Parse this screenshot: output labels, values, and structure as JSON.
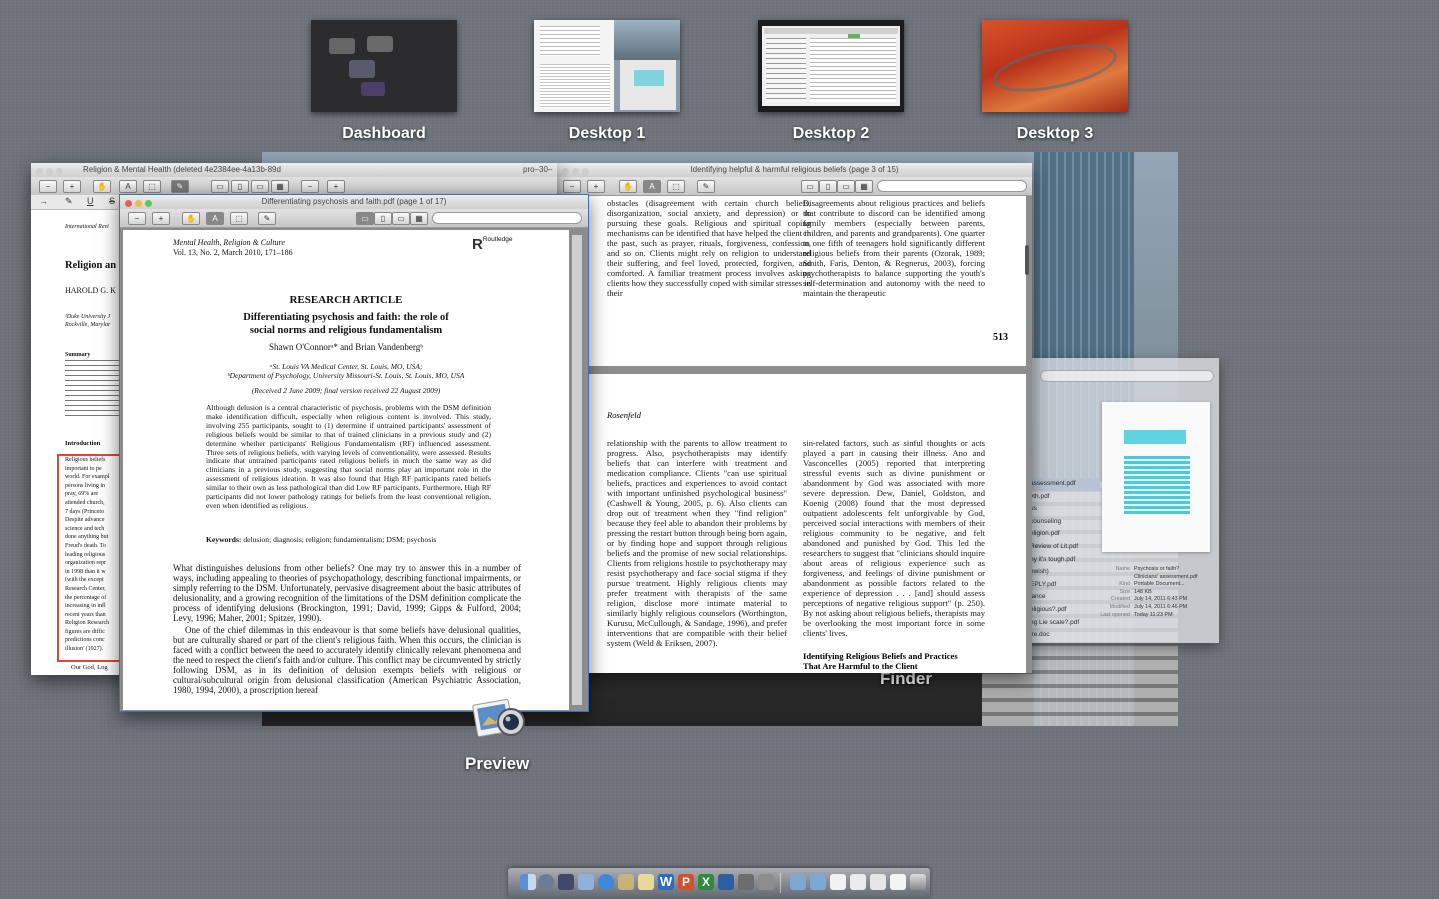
{
  "spaces": [
    {
      "label": "Dashboard"
    },
    {
      "label": "Desktop 1"
    },
    {
      "label": "Desktop 2"
    },
    {
      "label": "Desktop 3"
    }
  ],
  "windows": {
    "left_window": {
      "title": "Religion & Mental Health (deleted 4e2384ee-4a13b-89d",
      "journal": "International Revi",
      "heading": "Religion an",
      "author": "HAROLD G. K",
      "affil1": "¹Duke University J",
      "affil2": "Rockville, Marylar",
      "summary_head": "Summary",
      "intro_head": "Introduction",
      "box_lines": [
        "Religious beliefs",
        "important to pe",
        "world. For exampl",
        "persons living in",
        "pray, 69% are",
        "attended church,",
        "7 days (Princeto",
        "Despite advance",
        "science and tech",
        "done anything but",
        "Freud's death. To",
        "leading religious",
        "organization repr",
        "in 1998 than it w",
        "(with the except",
        "Research Center,",
        "the percentage of",
        "increasing in infl",
        "recent years than",
        "Religion Research",
        "figures are diffic",
        "predictions conc",
        "illusion' (1927)."
      ],
      "tail": "Our God, Log"
    },
    "front_window": {
      "title": "Differentiating psychosis and faith.pdf (page 1 of 17)",
      "journal_name": "Mental Health, Religion & Culture",
      "journal_vol": "Vol. 13, No. 2, March 2010, 171–186",
      "publisher": "Routledge",
      "article_type": "RESEARCH ARTICLE",
      "article_title_1": "Differentiating psychosis and faith: the role of",
      "article_title_2": "social norms and religious fundamentalism",
      "authors": "Shawn O'Connorᵃ* and Brian Vandenbergᵇ",
      "affil_a": "ᵃSt. Louis VA Medical Center, St. Louis, MO, USA;",
      "affil_b": "ᵇDepartment of Psychology, University Missouri-St. Louis, St. Louis, MO, USA",
      "received": "(Received 2 June 2009; final version received 22 August 2009)",
      "abstract": "Although delusion is a central characteristic of psychosis, problems with the DSM definition make identification difficult, especially when religious content is involved. This study, involving 255 participants, sought to (1) determine if untrained participants' assessment of religious beliefs would be similar to that of trained clinicians in a previous study and (2) determine whether participants' Religious Fundamentalism (RF) influenced assessment. Three sets of religious beliefs, with varying levels of conventionality, were assessed. Results indicate that untrained participants rated religious beliefs in much the same way as did clinicians in a previous study, suggesting that social norms play an important role in the assessment of religious ideation. It was also found that High RF participants rated beliefs similar to their own as less pathological than did Low RF participants. Furthermore, High RF participants did not lower pathology ratings for beliefs from the least conventional religion, even when identified as religious.",
      "keywords_label": "Keywords:",
      "keywords": "delusion; diagnosis; religion; fundamentalism; DSM; psychosis",
      "body_p1": "What distinguishes delusions from other beliefs? One may try to answer this in a number of ways, including appealing to theories of psychopathology, describing functional impairments, or simply referring to the DSM. Unfortunately, pervasive disagreement about the basic attributes of delusionality, and a growing recognition of the limitations of the DSM definition complicate the process of identifying delusions (Brockington, 1991; David, 1999; Gipps & Fulford, 2004; Levy, 1996; Maher, 2001; Spitzer, 1990).",
      "body_p2": "One of the chief dilemmas in this endeavour is that some beliefs have delusional qualities, but are culturally shared or part of the client's religious faith. When this occurs, the clinician is faced with a conflict between the need to accurately identify clinically relevant phenomena and the need to respect the client's faith and/or culture. This conflict may be circumvented by strictly following DSM, as in its definition of delusion exempts beliefs with religious or cultural/subcultural origin from delusional classification (American Psychiatric Association, 1980, 1994, 2000), a proscription hereaf"
    },
    "middle_window": {
      "title_stub": "pro–30–",
      "title": "Identifying helpful & harmful religious beliefs (page 3 of 15)",
      "top_left": "obstacles (disagreement with certain church beliefs, disorganization, social anxiety, and depression) or to pursuing these goals. Religious and spiritual coping mechanisms can be identified that have helped the client in the past, such as prayer, rituals, forgiveness, confession, and so on. Clients might rely on religion to understand their suffering, and feel loved, protected, forgiven, and comforted. A familiar treatment process involves asking clients how they successfully coped with similar stresses in their",
      "top_right": "Disagreements about religious practices and beliefs that contribute to discord can be identified among family members (especially between parents, children, and parents and grandparents). One quarter to one fifth of teenagers hold significantly different religious beliefs from their parents (Ozorak, 1989; Smith, Faris, Denton, & Regnerus, 2003), forcing psychotherapists to balance supporting the youth's self-determination and autonomy with the need to maintain the therapeutic",
      "page_number": "513",
      "running_head": "Rosenfeld",
      "bottom_left": "relationship with the parents to allow treatment to progress. Also, psychotherapists may identify beliefs that can interfere with treatment and medication compliance. Clients \"can use spiritual beliefs, practices and experiences to avoid contact with important unfinished psychological business\" (Cashwell & Young, 2005, p. 6). Also clients can drop out of treatment when they \"find religion\" because they feel able to abandon their problems by pressing the restart button through being born again, or by finding hope and support through religious beliefs and the promise of new social relationships. Clients from religions hostile to psychotherapy may resist psychotherapy and face social stigma if they pursue treatment. Highly religious clients may prefer treatment with therapists of the same religion, disclose more intimate material to similarly highly religious counselors (Worthington, Kurusu, McCullough, & Sandage, 1996), and prefer interventions that are compatible with their belief system (Weld & Eriksen, 2007).",
      "bottom_right": "sin-related factors, such as sinful thoughts or acts played a part in causing their illness. Ano and Vasconcelles (2005) reported that interpreting stressful events such as divine punishment or abandonment by God was associated with more severe depression. Dew, Daniel, Goldston, and Koenig (2008) found that the most depressed outpatient adolescents felt unforgivable by God, perceived social interactions with members of their religious community to be negative, and felt abandoned and punished by God. This led the researchers to suggest that \"clinicians should inquire about areas of religious experience such as forgiveness, and feelings of divine punishment or abandonment as possible factors related to the experience of depression . . . [and] should assess perceptions of negative religious support\" (p. 250). By not asking about religious beliefs, therapists may be overlooking the most important force in some clients' lives.",
      "section_head_1": "Identifying Religious Beliefs and Practices",
      "section_head_2": "That Are Harmful to the Client"
    },
    "finder_window": {
      "files": [
        "assessment.pdf",
        "vth.pdf",
        "us",
        "counseling",
        "eligion.pdf",
        "Review of Lit.pdf",
        "hy it's tough.pdf",
        "ewish)",
        "EPLY.pdf",
        "iance",
        "eligious?.pdf",
        "ng Lie scale?.pdf",
        "ire.doc"
      ],
      "info_labels": [
        "Name",
        "Kind",
        "Size",
        "Created",
        "Modified",
        "Last opened"
      ],
      "info_values": [
        "Psychosis or faith? Clinicians' assessment.pdf",
        "Portable Document...",
        "148 KB",
        "July 14, 2011 6:43 PM",
        "July 14, 2011 6:46 PM",
        "Today 11:23 PM"
      ]
    }
  },
  "app_labels": {
    "finder": "Finder",
    "preview": "Preview"
  },
  "dock": {
    "icon_count": 24
  }
}
